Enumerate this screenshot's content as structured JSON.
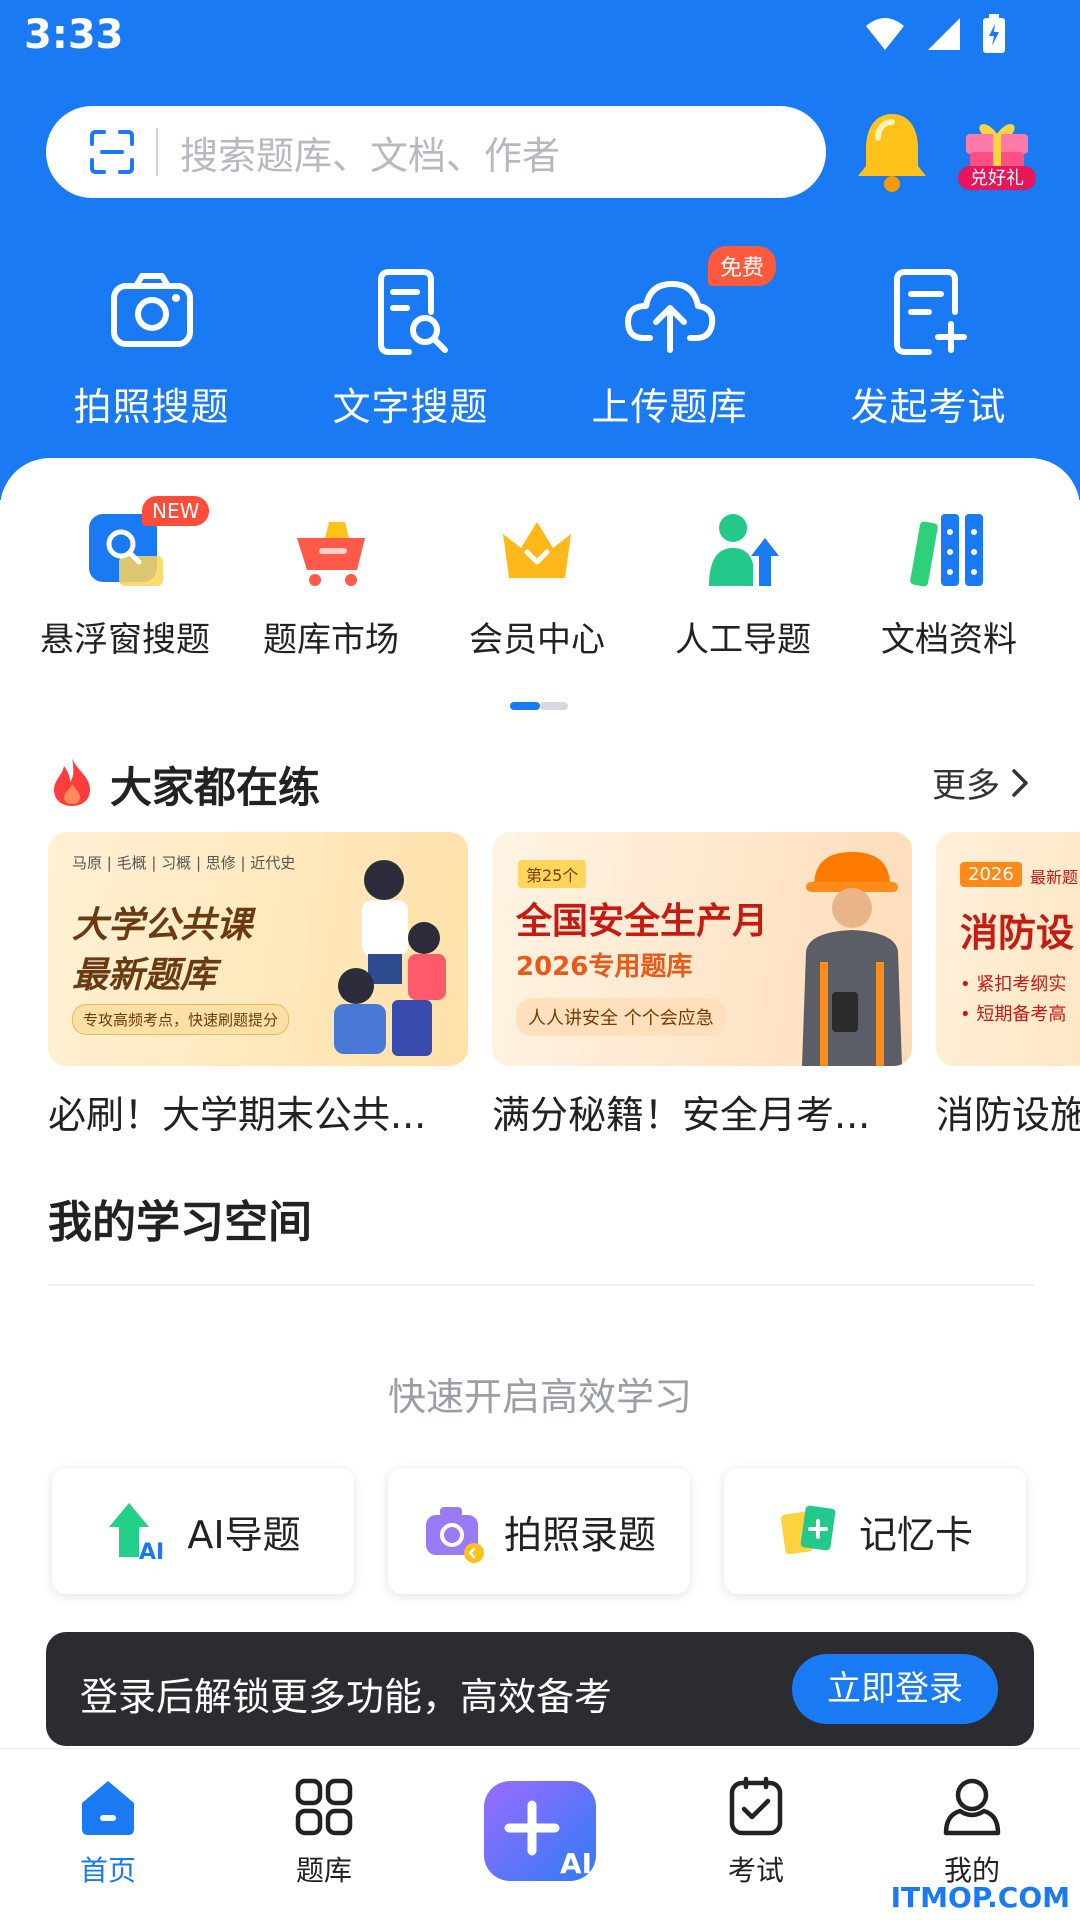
{
  "status": {
    "time": "3:33"
  },
  "search": {
    "placeholder": "搜索题库、文档、作者",
    "gift_label": "兑好礼"
  },
  "quick_actions": [
    {
      "label": "拍照搜题",
      "icon": "camera-icon"
    },
    {
      "label": "文字搜题",
      "icon": "text-search-icon"
    },
    {
      "label": "上传题库",
      "icon": "cloud-upload-icon",
      "badge": "免费"
    },
    {
      "label": "发起考试",
      "icon": "add-exam-icon"
    }
  ],
  "services": [
    {
      "label": "悬浮窗搜题",
      "icon": "float-search-icon",
      "badge": "NEW"
    },
    {
      "label": "题库市场",
      "icon": "cart-icon"
    },
    {
      "label": "会员中心",
      "icon": "crown-icon"
    },
    {
      "label": "人工导题",
      "icon": "person-upload-icon"
    },
    {
      "label": "文档资料",
      "icon": "books-icon"
    }
  ],
  "practice": {
    "title": "大家都在练",
    "more": "更多",
    "cards": [
      {
        "title": "必刷！大学期末公共...",
        "tags": "马原 | 毛概 | 习概 | 思修 | 近代史",
        "headline1": "大学公共课",
        "headline2": "最新题库",
        "sub": "专攻高频考点，快速刷题提分"
      },
      {
        "title": "满分秘籍！安全月考...",
        "tag": "第25个",
        "headline1": "全国安全生产月",
        "headline2": "2026专用题库",
        "sub": "人人讲安全 个个会应急"
      },
      {
        "title": "消防设施",
        "tag": "2026",
        "tag2": "最新题",
        "headline1": "消防设",
        "bullet1": "• 紧扣考纲实",
        "bullet2": "• 短期备考高"
      }
    ]
  },
  "study": {
    "title": "我的学习空间",
    "hint": "快速开启高效学习",
    "buttons": [
      {
        "label": "AI导题",
        "icon": "ai-upload-icon"
      },
      {
        "label": "拍照录题",
        "icon": "camera-record-icon"
      },
      {
        "label": "记忆卡",
        "icon": "memory-card-icon"
      }
    ]
  },
  "login": {
    "text": "登录后解锁更多功能，高效备考",
    "button": "立即登录"
  },
  "tabs": [
    {
      "label": "首页",
      "icon": "home-icon",
      "active": true
    },
    {
      "label": "题库",
      "icon": "grid-icon"
    },
    {
      "label": "",
      "icon": "ai-plus-icon",
      "ai_text": "AI"
    },
    {
      "label": "考试",
      "icon": "exam-icon"
    },
    {
      "label": "我的",
      "icon": "profile-icon"
    }
  ],
  "watermark": "ITMOP.COM",
  "colors": {
    "primary": "#1a7af3",
    "badge_red": "#ff5a3d",
    "login_bar": "#2b2c30"
  }
}
